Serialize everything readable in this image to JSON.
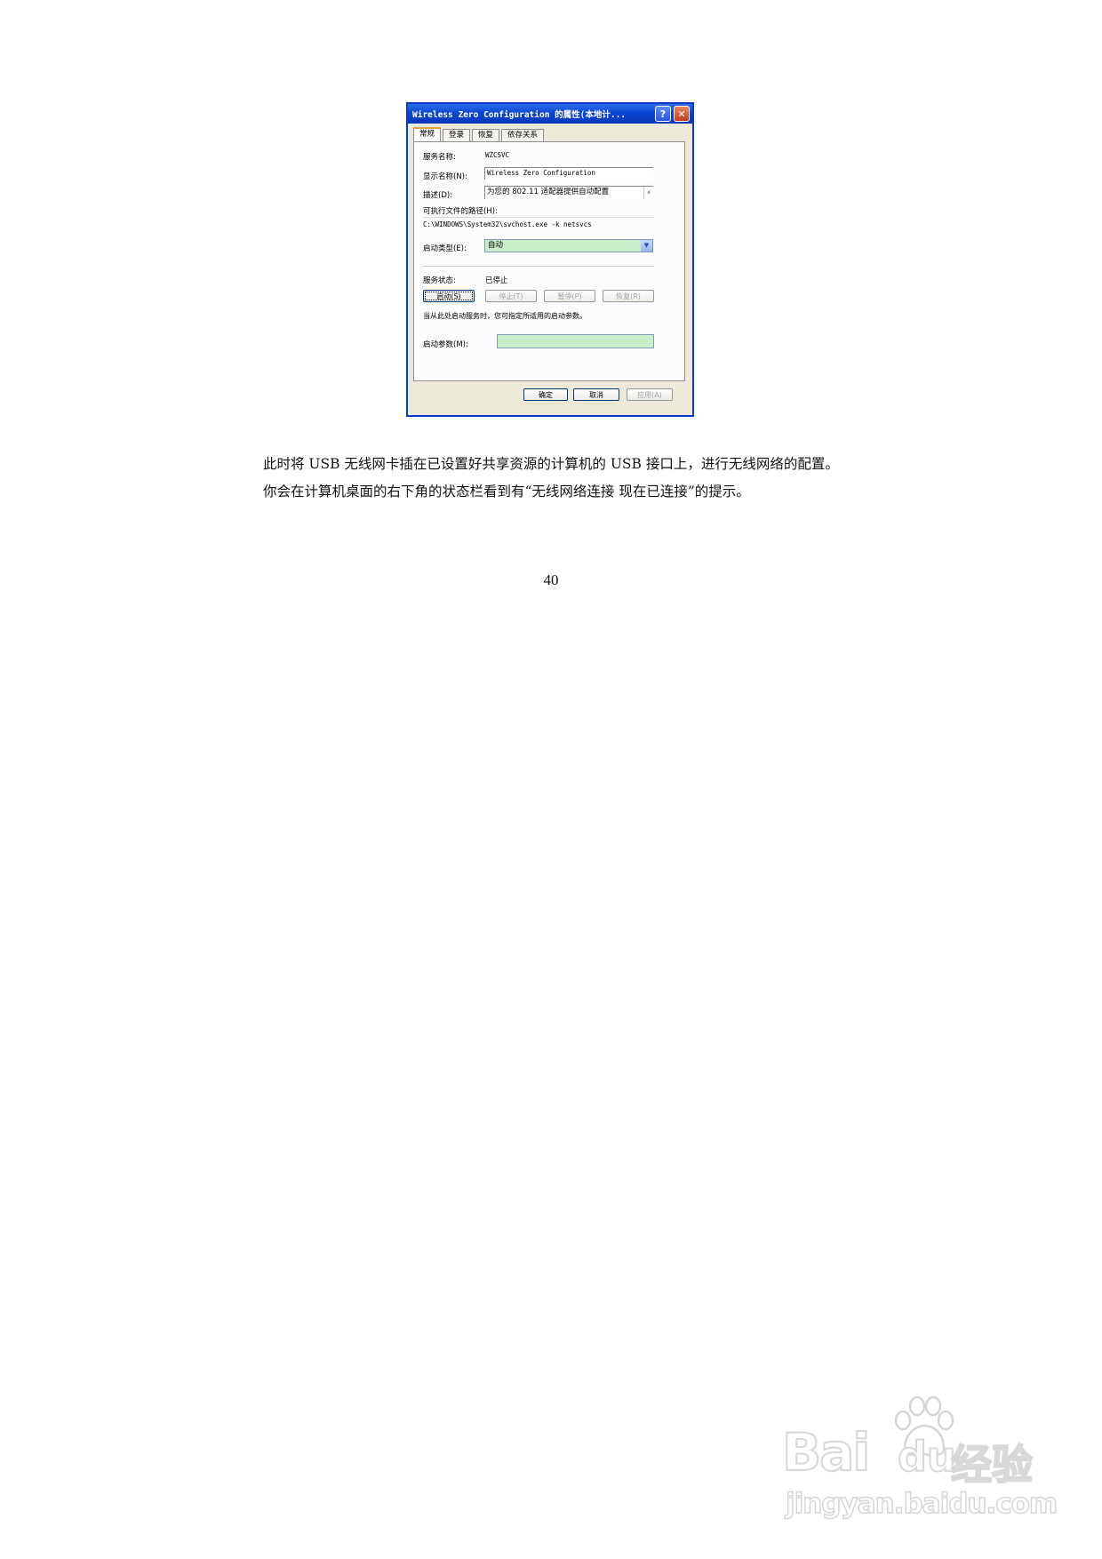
{
  "dialog": {
    "title": "Wireless Zero Configuration 的属性(本地计...",
    "help_label": "?",
    "close_label": "✕",
    "tabs": [
      {
        "label": "常规"
      },
      {
        "label": "登录"
      },
      {
        "label": "恢复"
      },
      {
        "label": "依存关系"
      }
    ],
    "service_name_label": "服务名称:",
    "service_name_value": "WZCSVC",
    "display_name_label": "显示名称(N):",
    "display_name_value": "Wireless Zero Configuration",
    "description_label": "描述(D):",
    "description_value": "为您的 802.11 适配器提供自动配置",
    "exe_path_label": "可执行文件的路径(H):",
    "exe_path_value": "C:\\WINDOWS\\System32\\svchost.exe -k netsvcs",
    "startup_type_label": "启动类型(E):",
    "startup_type_value": "自动",
    "service_status_label": "服务状态:",
    "service_status_value": "已停止",
    "start_button": "启动(S)",
    "stop_button": "停止(T)",
    "pause_button": "暂停(P)",
    "resume_button": "恢复(R)",
    "hint_text": "当从此处启动服务时，您可指定所适用的启动参数。",
    "start_params_label": "启动参数(M):",
    "ok_button": "确定",
    "cancel_button": "取消",
    "apply_button": "应用(A)"
  },
  "body_text": {
    "line1": "此时将 USB 无线网卡插在已设置好共享资源的计算机的 USB 接口上，进行无线网络的配置。",
    "line2": "你会在计算机桌面的右下角的状态栏看到有“无线网络连接 现在已连接”的提示。"
  },
  "page_number": "40",
  "watermark": {
    "brand": "Bai",
    "brand_du": "du",
    "brand_cn": "经验",
    "url": "jingyan.baidu.com"
  }
}
